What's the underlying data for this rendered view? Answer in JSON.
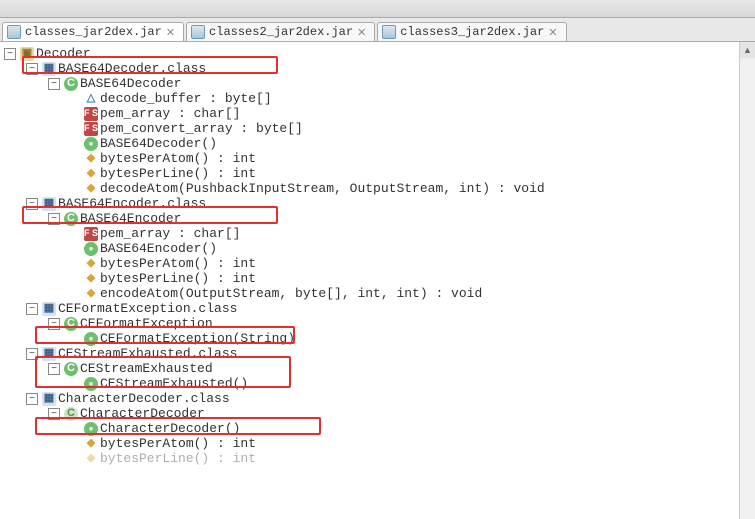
{
  "tabs": [
    {
      "label": "classes_jar2dex.jar",
      "active": true
    },
    {
      "label": "classes2_jar2dex.jar",
      "active": false
    },
    {
      "label": "classes3_jar2dex.jar",
      "active": false
    }
  ],
  "tree": {
    "root": "Decoder",
    "n0": "BASE64Decoder.class",
    "n0c": "BASE64Decoder",
    "n0m0": "decode_buffer : byte[]",
    "n0m1": "pem_array : char[]",
    "n0m2": "pem_convert_array : byte[]",
    "n0m3": "BASE64Decoder()",
    "n0m4": "bytesPerAtom() : int",
    "n0m5": "bytesPerLine() : int",
    "n0m6": "decodeAtom(PushbackInputStream, OutputStream, int) : void",
    "n1": "BASE64Encoder.class",
    "n1c": "BASE64Encoder",
    "n1m0": "pem_array : char[]",
    "n1m1": "BASE64Encoder()",
    "n1m2": "bytesPerAtom() : int",
    "n1m3": "bytesPerLine() : int",
    "n1m4": "encodeAtom(OutputStream, byte[], int, int) : void",
    "n2": "CEFormatException.class",
    "n2c": "CEFormatException",
    "n2m0": "CEFormatException(String)",
    "n3": "CEStreamExhausted.class",
    "n3c": "CEStreamExhausted",
    "n3m0": "CEStreamExhausted()",
    "n4": "CharacterDecoder.class",
    "n4c": "CharacterDecoder",
    "n4m0": "CharacterDecoder()",
    "n4m1": "bytesPerAtom() : int",
    "n4m2": "bytesPerLine() : int"
  }
}
